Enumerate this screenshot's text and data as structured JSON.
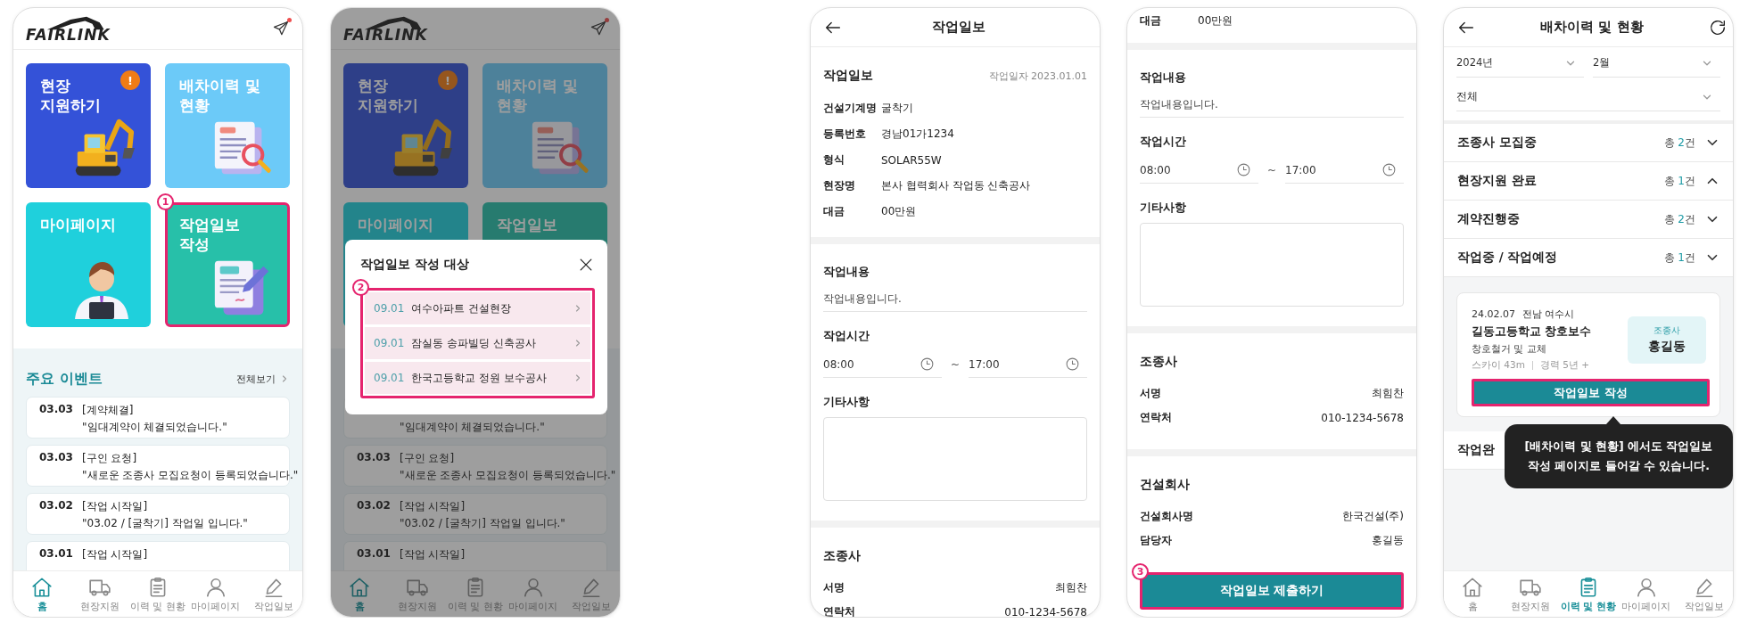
{
  "screens": [
    {
      "kind": "home",
      "dimmed": false,
      "logo": "FAIRLINK",
      "notification": true,
      "tiles": [
        {
          "label": "현장\n지원하기",
          "alert": "!",
          "highlighted": false
        },
        {
          "label": "배차이력 및\n현황",
          "highlighted": false
        },
        {
          "label": "마이페이지",
          "highlighted": false
        },
        {
          "label": "작업일보\n작성",
          "highlighted": true,
          "callout": "1"
        }
      ],
      "events": {
        "title": "주요 이벤트",
        "more": "전체보기",
        "items": [
          {
            "date": "03.03",
            "category": "[계약체결]",
            "message": "\"임대계약이 체결되었습니다.\""
          },
          {
            "date": "03.03",
            "category": "[구인 요청]",
            "message": "\"새로운 조종사 모집요청이 등록되었습니다.\""
          },
          {
            "date": "03.02",
            "category": "[작업 시작일]",
            "message": "\"03.02 / [굴착기] 작업일 입니다.\""
          },
          {
            "date": "03.01",
            "category": "[작업 시작일]"
          }
        ]
      },
      "tabs": [
        {
          "label": "홈",
          "selected": true
        },
        {
          "label": "현장지원",
          "selected": false
        },
        {
          "label": "이력 및 현황",
          "selected": false
        },
        {
          "label": "마이페이지",
          "selected": false
        },
        {
          "label": "작업일보",
          "selected": false
        }
      ]
    },
    {
      "kind": "home",
      "dimmed": true,
      "logo": "FAIRLINK",
      "notification": true,
      "tiles": [
        {
          "label": "현장\n지원하기",
          "alert": "!",
          "highlighted": false
        },
        {
          "label": "배차이력 및\n현황",
          "highlighted": false
        },
        {
          "label": "마이페이지",
          "highlighted": false
        },
        {
          "label": "작업일보",
          "highlighted": false
        }
      ],
      "events": {
        "items": [
          {
            "message": "\"임대계약이 체결되었습니다.\""
          },
          {
            "date": "03.03",
            "category": "[구인 요청]",
            "message": "\"새로운 조종사 모집요청이 등록되었습니다.\""
          },
          {
            "date": "03.02",
            "category": "[작업 시작일]",
            "message": "\"03.02 / [굴착기] 작업일 입니다.\""
          },
          {
            "date": "03.01",
            "category": "[작업 시작일]"
          }
        ]
      },
      "modal": {
        "title": "작업일보 작성 대상",
        "highlighted": true,
        "callout": "2",
        "items": [
          {
            "date": "09.01",
            "name": "여수아파트 건설현장"
          },
          {
            "date": "09.01",
            "name": "잠실동 송파빌딩 신축공사"
          },
          {
            "date": "09.01",
            "name": "한국고등학교 정원 보수공사"
          }
        ]
      },
      "tabs": [
        {
          "label": "홈",
          "selected": true
        },
        {
          "label": "현장지원",
          "selected": false
        },
        {
          "label": "이력 및 현황",
          "selected": false
        },
        {
          "label": "마이페이지",
          "selected": false
        },
        {
          "label": "작업일보",
          "selected": false
        }
      ]
    },
    {
      "kind": "form",
      "header": {
        "title": "작업일보",
        "back": true
      },
      "sections": [
        {
          "items": [
            {
              "kind": "heading",
              "text": "작업일보",
              "aside": "작업일자 2023.01.01"
            },
            {
              "kind": "field",
              "label": "건설기계명",
              "value": "굴착기"
            },
            {
              "kind": "field",
              "label": "등록번호",
              "value": "경남01가1234"
            },
            {
              "kind": "field",
              "label": "형식",
              "value": "SOLAR55W"
            },
            {
              "kind": "field",
              "label": "현장명",
              "value": "본사 협력회사 작업동 신축공사"
            },
            {
              "kind": "field",
              "label": "대금",
              "value": "00만원"
            }
          ]
        },
        {
          "items": [
            {
              "kind": "label",
              "text": "작업내용"
            },
            {
              "kind": "text",
              "text": "작업내용입니다."
            },
            {
              "kind": "label",
              "text": "작업시간"
            },
            {
              "kind": "time",
              "start": "08:00",
              "separator": "~",
              "end": "17:00"
            },
            {
              "kind": "label",
              "text": "기타사항"
            },
            {
              "kind": "memo"
            }
          ]
        },
        {
          "items": [
            {
              "kind": "heading",
              "text": "조종사"
            },
            {
              "kind": "pair",
              "label": "서명",
              "value": "최힘찬"
            },
            {
              "kind": "pair",
              "label": "연락처",
              "value": "010-1234-5678"
            }
          ]
        }
      ]
    },
    {
      "kind": "form",
      "sections": [
        {
          "items": [
            {
              "kind": "field",
              "label": "대금",
              "value": "00만원"
            }
          ]
        },
        {
          "items": [
            {
              "kind": "label",
              "text": "작업내용"
            },
            {
              "kind": "text",
              "text": "작업내용입니다."
            },
            {
              "kind": "label",
              "text": "작업시간"
            },
            {
              "kind": "time",
              "start": "08:00",
              "separator": "~",
              "end": "17:00"
            },
            {
              "kind": "label",
              "text": "기타사항"
            },
            {
              "kind": "memo"
            }
          ]
        },
        {
          "items": [
            {
              "kind": "heading",
              "text": "조종사"
            },
            {
              "kind": "pair",
              "label": "서명",
              "value": "최힘찬"
            },
            {
              "kind": "pair",
              "label": "연락처",
              "value": "010-1234-5678"
            }
          ]
        },
        {
          "items": [
            {
              "kind": "heading",
              "text": "건설회사"
            },
            {
              "kind": "pair",
              "label": "건설회사명",
              "value": "한국건설(주)"
            },
            {
              "kind": "pair",
              "label": "담당자",
              "value": "홍길동"
            }
          ]
        }
      ],
      "submit": {
        "label": "작업일보 제출하기",
        "highlighted": true,
        "callout": "3"
      }
    },
    {
      "kind": "history",
      "header": {
        "title": "배차이력 및 현황",
        "back": true,
        "refresh": true
      },
      "filter_rows": [
        [
          "2024년",
          "2월"
        ],
        [
          "전체"
        ]
      ],
      "accordion": [
        {
          "label": "조종사 모집중",
          "count": "총 **2**건",
          "expanded": false
        },
        {
          "label": "현장지원 완료",
          "count": "총 **1**건",
          "expanded": true
        },
        {
          "label": "계약진행중",
          "count": "총 **2**건",
          "expanded": false
        },
        {
          "label": "작업중 / 작업예정",
          "count": "총 **1**건",
          "expanded": false
        }
      ],
      "card": {
        "date": "24.02.07",
        "region": "전남 여수시",
        "title": "길동고등학교 창호보수",
        "subtitle": "창호철거 및 교체",
        "meta": [
          "스카이 43m",
          "경력 5년 +"
        ],
        "role": "조종사",
        "person": "홍길동",
        "button": {
          "label": "작업일보 작성",
          "highlighted": true
        }
      },
      "trailing_rows": [
        {
          "label": "작업완"
        }
      ],
      "tooltip": {
        "text": "[배차이력 및 현황] 에서도 작업일보\n작성 페이지로 들어갈 수 있습니다."
      },
      "tabs": [
        {
          "label": "홈",
          "selected": false
        },
        {
          "label": "현장지원",
          "selected": false
        },
        {
          "label": "이력 및 현황",
          "selected": true
        },
        {
          "label": "마이페이지",
          "selected": false
        },
        {
          "label": "작업일보",
          "selected": false
        }
      ]
    }
  ]
}
